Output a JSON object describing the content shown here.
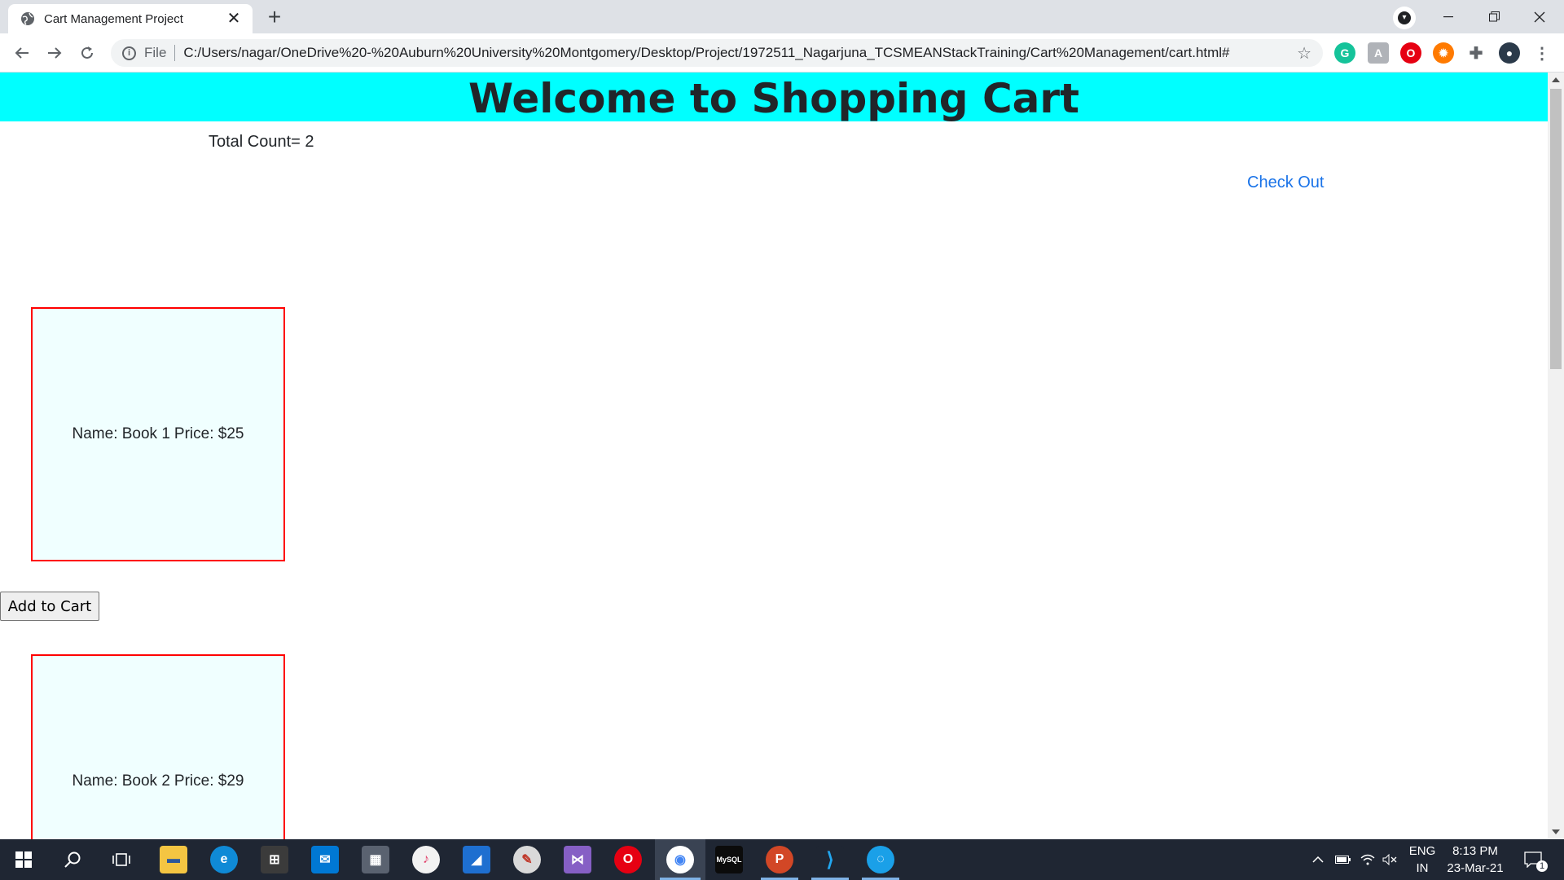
{
  "browser": {
    "tab_title": "Cart Management Project",
    "new_tab_label": "+",
    "close_tab_label": "✕",
    "url_scheme": "File",
    "url": "C:/Users/nagar/OneDrive%20-%20Auburn%20University%20Montgomery/Desktop/Project/1972511_Nagarjuna_TCSMEANStackTraining/Cart%20Management/cart.html#",
    "icons": [
      "globe-icon",
      "back-icon",
      "forward-icon",
      "reload-icon",
      "info-icon",
      "star-icon",
      "grammarly-icon",
      "pdf-icon",
      "opera-icon",
      "fire-icon",
      "extensions-icon",
      "avatar-icon",
      "menu-icon"
    ]
  },
  "page": {
    "header_title": "Welcome to Shopping Cart",
    "total_count_label": "Total Count=",
    "total_count": "2",
    "checkout_label": "Check Out",
    "products": [
      {
        "name_label": "Name: Book 1",
        "price_label": "Price: $25"
      },
      {
        "name_label": "Name: Book 2",
        "price_label": "Price: $29"
      }
    ],
    "add_to_cart_label": "Add to Cart"
  },
  "taskbar": {
    "apps": [
      "start-icon",
      "search-icon",
      "task-view-icon",
      "file-explorer-icon",
      "edge-icon",
      "store-icon",
      "mail-icon",
      "calculator-icon",
      "itunes-icon",
      "app-icon",
      "paint-icon",
      "visual-studio-icon",
      "opera-icon",
      "chrome-icon",
      "mysql-icon",
      "powerpoint-icon",
      "vscode-icon",
      "app-icon"
    ],
    "lang_top": "ENG",
    "lang_bottom": "IN",
    "time": "8:13 PM",
    "date": "23-Mar-21",
    "notification_count": "1"
  },
  "colors": {
    "header_bg": "#00ffff",
    "card_border": "#ff0000",
    "card_bg": "#f0ffff",
    "link": "#1a73e8",
    "taskbar_bg": "#1f2633"
  }
}
